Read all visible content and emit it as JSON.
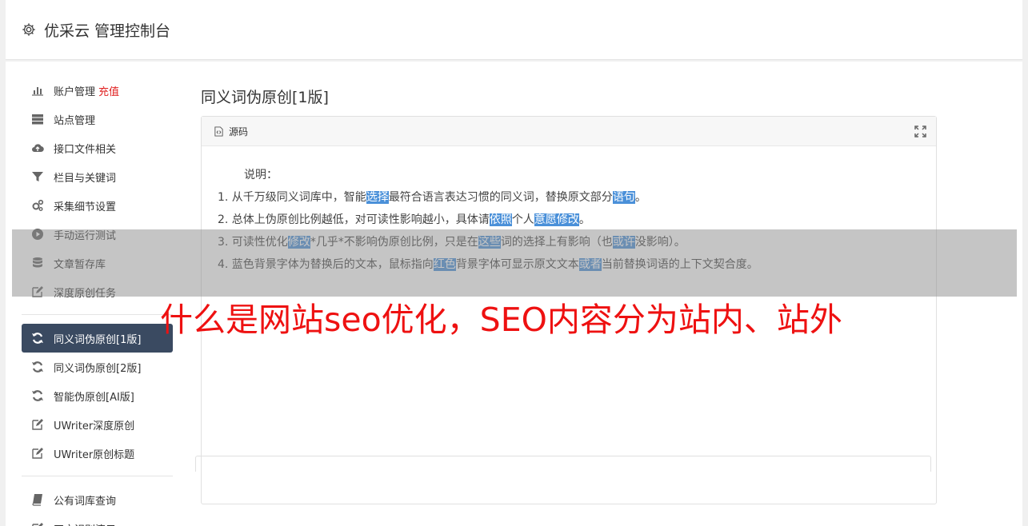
{
  "header": {
    "title": "优采云 管理控制台",
    "icon": "gear-icon"
  },
  "sidebar": {
    "group1": [
      {
        "label": "账户管理",
        "badge": "充值",
        "icon": "bar-chart-icon"
      },
      {
        "label": "站点管理",
        "icon": "server-icon"
      },
      {
        "label": "接口文件相关",
        "icon": "cloud-upload-icon"
      },
      {
        "label": "栏目与关键词",
        "icon": "filter-icon"
      },
      {
        "label": "采集细节设置",
        "icon": "gears-icon"
      },
      {
        "label": "手动运行测试",
        "icon": "play-circle-icon"
      },
      {
        "label": "文章暂存库",
        "icon": "database-icon"
      },
      {
        "label": "深度原创任务",
        "icon": "edit-icon"
      }
    ],
    "group2": [
      {
        "label": "同义词伪原创[1版]",
        "icon": "refresh-icon",
        "active": true
      },
      {
        "label": "同义词伪原创[2版]",
        "icon": "refresh-icon"
      },
      {
        "label": "智能伪原创[AI版]",
        "icon": "refresh-icon"
      },
      {
        "label": "UWriter深度原创",
        "icon": "edit-icon"
      },
      {
        "label": "UWriter原创标题",
        "icon": "edit-icon"
      }
    ],
    "group3": [
      {
        "label": "公有词库查询",
        "icon": "book-icon"
      },
      {
        "label": "正文识别演示",
        "icon": "edit-icon"
      }
    ]
  },
  "main": {
    "page_title": "同义词伪原创[1版]",
    "panel_title": "源码",
    "intro": "说明：",
    "lines": [
      [
        {
          "t": "1. 从千万级同义词库中，智能"
        },
        {
          "t": "选择",
          "hl": true
        },
        {
          "t": "最符合语言表达习惯的同义词，替换原文部分"
        },
        {
          "t": "语句",
          "hl": true
        },
        {
          "t": "。"
        }
      ],
      [
        {
          "t": "2. 总体上伪原创比例越低，对可读性影响越小，具体请"
        },
        {
          "t": "依照",
          "hl": true
        },
        {
          "t": "个人"
        },
        {
          "t": "意愿",
          "hl": true
        },
        {
          "t": "修改",
          "hl": true
        },
        {
          "t": "。"
        }
      ],
      [
        {
          "t": "3. 可读性优化"
        },
        {
          "t": "修改",
          "hl": true
        },
        {
          "t": "*几乎*不影响伪原创比例，只是在"
        },
        {
          "t": "这些",
          "hl": true
        },
        {
          "t": "词的选择上有影响（也"
        },
        {
          "t": "或许",
          "hl": true
        },
        {
          "t": "没影响）。"
        }
      ],
      [
        {
          "t": "4. 蓝色背景字体为替换后的文本，鼠标指向"
        },
        {
          "t": "红色",
          "hl": true
        },
        {
          "t": "背景字体可显示原文文本"
        },
        {
          "t": "或者",
          "hl": true
        },
        {
          "t": "当前替换词语的上下文契合度。"
        }
      ]
    ]
  },
  "overlay": {
    "headline": "什么是网站seo优化，SEO内容分为站内、站外"
  },
  "colors": {
    "active_bg": "#3a4a61",
    "highlight": "#4a90d9",
    "badge": "#e02020",
    "headline": "#ee1111"
  }
}
